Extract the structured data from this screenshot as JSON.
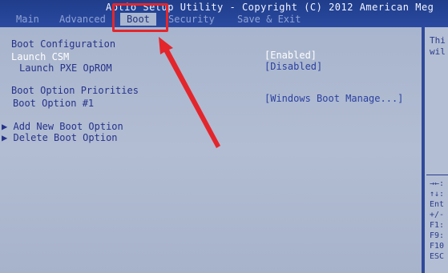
{
  "header": {
    "title": "Aptio Setup Utility - Copyright (C) 2012 American Meg",
    "tabs": [
      {
        "label": "Main"
      },
      {
        "label": "Advanced"
      },
      {
        "label": "Boot"
      },
      {
        "label": "Security"
      },
      {
        "label": "Save & Exit"
      }
    ]
  },
  "main": {
    "section_title": "Boot Configuration",
    "launch_csm": {
      "label": "Launch CSM",
      "value": "[Enabled]"
    },
    "launch_pxe": {
      "label": "Launch PXE OpROM",
      "value": "[Disabled]"
    },
    "priorities_title": "Boot Option Priorities",
    "boot_option_1": {
      "label": "Boot Option #1",
      "value": "[Windows Boot Manage...]"
    },
    "add_new": {
      "arrow": "▶",
      "label": "Add New Boot Option"
    },
    "delete": {
      "arrow": "▶",
      "label": "Delete Boot Option"
    }
  },
  "help": {
    "desc_line1": "Thi",
    "desc_line2": "wil",
    "keys": [
      "→←:",
      "↑↓:",
      "Ent",
      "+/-",
      "F1:",
      "F9:",
      "F10",
      "ESC"
    ]
  },
  "colors": {
    "header_blue": "#1f3d8a",
    "panel_grey": "#a6b3cc",
    "annotation_red": "#e3262c"
  }
}
